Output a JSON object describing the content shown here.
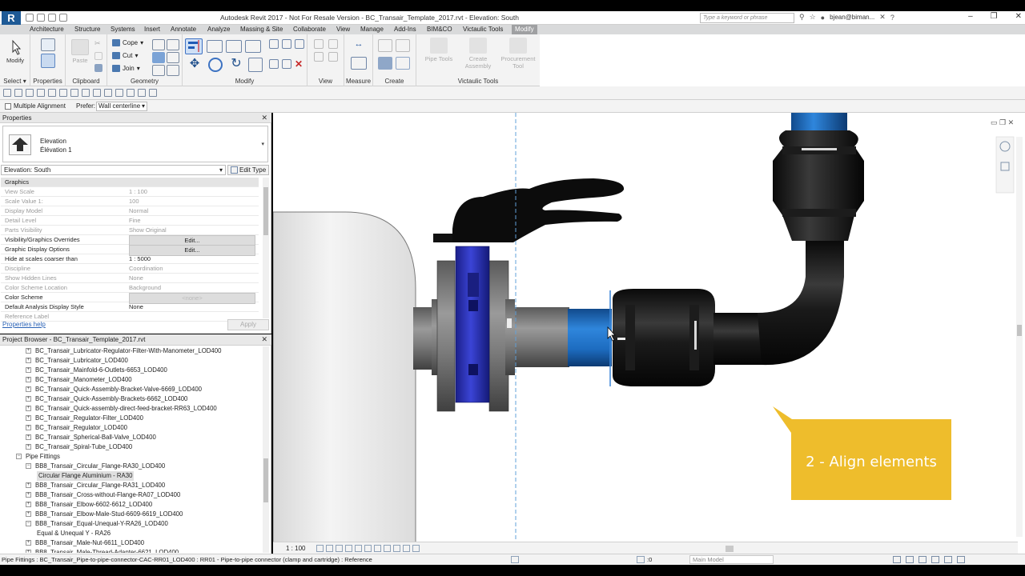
{
  "window": {
    "title": "Autodesk Revit 2017 - Not For Resale Version -    BC_Transair_Template_2017.rvt - Elevation: South",
    "search_placeholder": "Type a keyword or phrase",
    "user": "bjean@biman...",
    "app_letter": "R"
  },
  "tabs": [
    "Architecture",
    "Structure",
    "Systems",
    "Insert",
    "Annotate",
    "Analyze",
    "Massing & Site",
    "Collaborate",
    "View",
    "Manage",
    "Add-Ins",
    "BIM&CO",
    "Victaulic Tools",
    "Modify"
  ],
  "active_tab": "Modify",
  "ribbon": {
    "modify_label": "Modify",
    "paste_label": "Paste",
    "cope_label": "Cope",
    "cut_label": "Cut",
    "join_label": "Join",
    "pipe_tools_label": "Pipe Tools",
    "create_assembly_label": "Create Assembly",
    "procurement_tool_label": "Procurement Tool",
    "panels": [
      "Select",
      "Properties",
      "Clipboard",
      "Geometry",
      "Modify",
      "View",
      "Measure",
      "Create",
      "Victaulic Tools"
    ]
  },
  "options_bar": {
    "multiple_alignment": "Multiple Alignment",
    "prefer_label": "Prefer:",
    "prefer_value": "Wall centerline"
  },
  "properties": {
    "header": "Properties",
    "type_line1": "Elevation",
    "type_line2": "Élévation 1",
    "view_selector": "Elevation: South",
    "edit_type": "Edit Type",
    "rows": [
      {
        "k": "Graphics",
        "v": "",
        "style": "group"
      },
      {
        "k": "View Scale",
        "v": "1 : 100",
        "style": "grey"
      },
      {
        "k": "Scale Value    1:",
        "v": "100",
        "style": "grey"
      },
      {
        "k": "Display Model",
        "v": "Normal",
        "style": "grey"
      },
      {
        "k": "Detail Level",
        "v": "Fine",
        "style": "grey"
      },
      {
        "k": "Parts Visibility",
        "v": "Show Original",
        "style": "grey"
      },
      {
        "k": "Visibility/Graphics Overrides",
        "v": "Edit...",
        "style": "btn"
      },
      {
        "k": "Graphic Display Options",
        "v": "Edit...",
        "style": "btn"
      },
      {
        "k": "Hide at scales coarser than",
        "v": "1 : 5000",
        "style": ""
      },
      {
        "k": "Discipline",
        "v": "Coordination",
        "style": "grey"
      },
      {
        "k": "Show Hidden Lines",
        "v": "None",
        "style": "grey"
      },
      {
        "k": "Color Scheme Location",
        "v": "Background",
        "style": "grey"
      },
      {
        "k": "Color Scheme",
        "v": "<none>",
        "style": "btn-dim"
      },
      {
        "k": "Default Analysis Display Style",
        "v": "None",
        "style": ""
      },
      {
        "k": "Reference Label",
        "v": "",
        "style": "grey"
      }
    ],
    "help_link": "Properties help",
    "apply": "Apply"
  },
  "project_browser": {
    "header": "Project Browser - BC_Transair_Template_2017.rvt",
    "items": [
      {
        "label": "BC_Transair_Lubricator-Regulator-Filter-With-Manometer_LOD400",
        "level": 2,
        "exp": "+"
      },
      {
        "label": "BC_Transair_Lubricator_LOD400",
        "level": 2,
        "exp": "+"
      },
      {
        "label": "BC_Transair_Mainfold-6-Outlets-6653_LOD400",
        "level": 2,
        "exp": "+"
      },
      {
        "label": "BC_Transair_Manometer_LOD400",
        "level": 2,
        "exp": "+"
      },
      {
        "label": "BC_Transair_Quick-Assembly-Bracket-Valve-6669_LOD400",
        "level": 2,
        "exp": "+"
      },
      {
        "label": "BC_Transair_Quick-Assembly-Brackets-6662_LOD400",
        "level": 2,
        "exp": "+"
      },
      {
        "label": "BC_Transair_Quick-assembly-direct-feed-bracket-RR63_LOD400",
        "level": 2,
        "exp": "+"
      },
      {
        "label": "BC_Transair_Regulator-Filter_LOD400",
        "level": 2,
        "exp": "+"
      },
      {
        "label": "BC_Transair_Regulator_LOD400",
        "level": 2,
        "exp": "+"
      },
      {
        "label": "BC_Transair_Spherical-Ball-Valve_LOD400",
        "level": 2,
        "exp": "+"
      },
      {
        "label": "BC_Transair_Spiral-Tube_LOD400",
        "level": 2,
        "exp": "+"
      },
      {
        "label": "Pipe Fittings",
        "level": 1,
        "exp": "−"
      },
      {
        "label": "BB8_Transair_Circular_Flange-RA30_LOD400",
        "level": 2,
        "exp": "−"
      },
      {
        "label": "Circular Flange Aluminium - RA30",
        "level": 3,
        "exp": "",
        "selected": true
      },
      {
        "label": "BB8_Transair_Circular_Flange-RA31_LOD400",
        "level": 2,
        "exp": "+"
      },
      {
        "label": "BB8_Transair_Cross-without-Flange-RA07_LOD400",
        "level": 2,
        "exp": "+"
      },
      {
        "label": "BB8_Transair_Elbow-6602-6612_LOD400",
        "level": 2,
        "exp": "+"
      },
      {
        "label": "BB8_Transair_Elbow-Male-Stud-6609-6619_LOD400",
        "level": 2,
        "exp": "+"
      },
      {
        "label": "BB8_Transair_Equal-Unequal-Y-RA26_LOD400",
        "level": 2,
        "exp": "−"
      },
      {
        "label": "Equal & Unequal Y - RA26",
        "level": 3,
        "exp": ""
      },
      {
        "label": "BB8_Transair_Male-Nut-6611_LOD400",
        "level": 2,
        "exp": "+"
      },
      {
        "label": "BB8_Transair_Male-Thread-Adapter-6621_LOD400",
        "level": 2,
        "exp": "+"
      }
    ]
  },
  "view_controls": {
    "scale": "1 : 100"
  },
  "callout": {
    "text": "2 - Align elements"
  },
  "status": {
    "text": "Pipe Fittings : BC_Transair_Pipe-to-pipe-connector-CAC-RR01_LOD400 : RR01 - Pipe-to-pipe connector (clamp and cartridge) : Reference",
    "selection_count": ":0",
    "model": "Main Model"
  },
  "colors": {
    "pipe_blue": "#1f6fc4",
    "valve_blue": "#2a32b8",
    "callout_yellow": "#eebd2c",
    "accent": "#1e5a96"
  }
}
